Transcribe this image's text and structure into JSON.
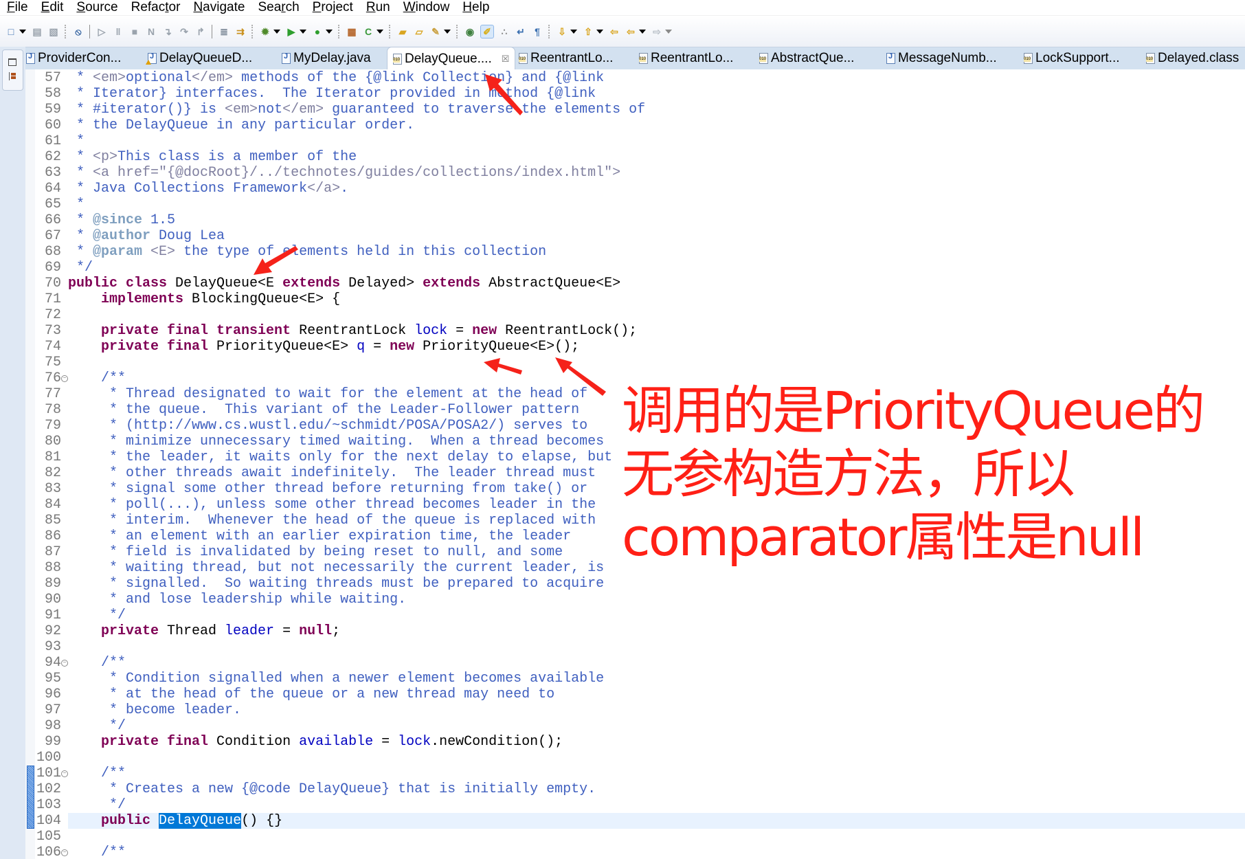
{
  "menubar": {
    "items": [
      {
        "label": "File",
        "mnemonic": 0
      },
      {
        "label": "Edit",
        "mnemonic": 0
      },
      {
        "label": "Source",
        "mnemonic": 0
      },
      {
        "label": "Refactor",
        "mnemonic": 5
      },
      {
        "label": "Navigate",
        "mnemonic": 0
      },
      {
        "label": "Search",
        "mnemonic": 3
      },
      {
        "label": "Project",
        "mnemonic": 0
      },
      {
        "label": "Run",
        "mnemonic": 0
      },
      {
        "label": "Window",
        "mnemonic": 0
      },
      {
        "label": "Help",
        "mnemonic": 0
      }
    ]
  },
  "toolbar": {
    "icons": [
      "new-icon",
      "dropdown",
      "save-icon",
      "save-all-icon",
      "sep",
      "skip-breakpoints-icon",
      "sep-solid",
      "resume-icon",
      "suspend-icon",
      "terminate-icon",
      "disconnect-icon",
      "step-into-icon",
      "step-over-icon",
      "step-return-icon",
      "sep-solid",
      "drop-to-frame-icon",
      "use-step-filters-icon",
      "sep",
      "debug-icon",
      "dropdown",
      "run-icon",
      "dropdown",
      "run-external-tool-icon",
      "dropdown",
      "sep",
      "new-java-package-icon",
      "new-java-class-icon",
      "dropdown",
      "sep",
      "open-type-icon",
      "open-task-icon",
      "search-icon",
      "dropdown",
      "sep",
      "toggle-breadcrumb-icon",
      "toggle-mark-occurrences-icon",
      "toggle-block-selection-icon",
      "word-wrap-icon",
      "show-whitespace-icon",
      "sep",
      "next-annotation-icon",
      "dropdown",
      "previous-annotation-icon",
      "dropdown",
      "last-edit-location-icon",
      "back-icon",
      "dropdown",
      "forward-icon",
      "dropdown-disabled"
    ]
  },
  "tabs": [
    {
      "label": "ProviderCon...",
      "icon": "java-file-icon",
      "active": false
    },
    {
      "label": "DelayQueueD...",
      "icon": "java-file-warning-icon",
      "active": false
    },
    {
      "label": "MyDelay.java",
      "icon": "java-file-icon",
      "active": false
    },
    {
      "label": "DelayQueue....",
      "icon": "class-file-icon",
      "active": true,
      "close": "☒"
    },
    {
      "label": "ReentrantLo...",
      "icon": "class-file-icon",
      "active": false
    },
    {
      "label": "ReentrantLo...",
      "icon": "class-file-icon",
      "active": false
    },
    {
      "label": "AbstractQue...",
      "icon": "class-file-icon",
      "active": false
    },
    {
      "label": "MessageNumb...",
      "icon": "java-file-icon",
      "active": false
    },
    {
      "label": "LockSupport...",
      "icon": "class-file-icon",
      "active": false
    },
    {
      "label": "Delayed.class",
      "icon": "class-file-icon",
      "active": false
    }
  ],
  "editor": {
    "current_line": 104,
    "folded_lines": [
      76,
      94,
      101,
      106
    ],
    "marker_lines": [
      101,
      104
    ],
    "lines": [
      {
        "n": 57,
        "t": [
          [
            "doc",
            " * "
          ],
          [
            "html",
            "<em>"
          ],
          [
            "doc",
            "optional"
          ],
          [
            "html",
            "</em>"
          ],
          [
            "doc",
            " methods of the {@link Collection} and {@link"
          ]
        ]
      },
      {
        "n": 58,
        "t": [
          [
            "doc",
            " * Iterator} interfaces.  The Iterator provided in method {@link"
          ]
        ]
      },
      {
        "n": 59,
        "t": [
          [
            "doc",
            " * #iterator()} is "
          ],
          [
            "html",
            "<em>"
          ],
          [
            "doc",
            "not"
          ],
          [
            "html",
            "</em>"
          ],
          [
            "doc",
            " guaranteed to traverse the elements of"
          ]
        ]
      },
      {
        "n": 60,
        "t": [
          [
            "doc",
            " * the DelayQueue in any particular order."
          ]
        ]
      },
      {
        "n": 61,
        "t": [
          [
            "doc",
            " *"
          ]
        ]
      },
      {
        "n": 62,
        "t": [
          [
            "doc",
            " * "
          ],
          [
            "html",
            "<p>"
          ],
          [
            "doc",
            "This class is a member of the"
          ]
        ]
      },
      {
        "n": 63,
        "t": [
          [
            "doc",
            " * "
          ],
          [
            "html",
            "<a href=\"{@docRoot}/../technotes/guides/collections/index.html\">"
          ]
        ]
      },
      {
        "n": 64,
        "t": [
          [
            "doc",
            " * Java Collections Framework"
          ],
          [
            "html",
            "</a>"
          ],
          [
            "doc",
            "."
          ]
        ]
      },
      {
        "n": 65,
        "t": [
          [
            "doc",
            " *"
          ]
        ]
      },
      {
        "n": 66,
        "t": [
          [
            "doc",
            " * "
          ],
          [
            "tag",
            "@since"
          ],
          [
            "doc",
            " 1.5"
          ]
        ]
      },
      {
        "n": 67,
        "t": [
          [
            "doc",
            " * "
          ],
          [
            "tag",
            "@author"
          ],
          [
            "doc",
            " Doug Lea"
          ]
        ]
      },
      {
        "n": 68,
        "t": [
          [
            "doc",
            " * "
          ],
          [
            "tag",
            "@param"
          ],
          [
            "doc",
            " "
          ],
          [
            "html",
            "<E>"
          ],
          [
            "doc",
            " the type of elements held in this collection"
          ]
        ]
      },
      {
        "n": 69,
        "t": [
          [
            "doc",
            " */"
          ]
        ]
      },
      {
        "n": 70,
        "t": [
          [
            "kw",
            "public class"
          ],
          [
            "txt",
            " DelayQueue<E "
          ],
          [
            "kw",
            "extends"
          ],
          [
            "txt",
            " Delayed> "
          ],
          [
            "kw",
            "extends"
          ],
          [
            "txt",
            " AbstractQueue<E>"
          ]
        ]
      },
      {
        "n": 71,
        "t": [
          [
            "txt",
            "    "
          ],
          [
            "kw",
            "implements"
          ],
          [
            "txt",
            " BlockingQueue<E> {"
          ]
        ]
      },
      {
        "n": 72,
        "t": []
      },
      {
        "n": 73,
        "t": [
          [
            "txt",
            "    "
          ],
          [
            "kw",
            "private final transient"
          ],
          [
            "txt",
            " ReentrantLock "
          ],
          [
            "field",
            "lock"
          ],
          [
            "txt",
            " = "
          ],
          [
            "kw",
            "new"
          ],
          [
            "txt",
            " ReentrantLock();"
          ]
        ]
      },
      {
        "n": 74,
        "t": [
          [
            "txt",
            "    "
          ],
          [
            "kw",
            "private final"
          ],
          [
            "txt",
            " PriorityQueue<E> "
          ],
          [
            "field",
            "q"
          ],
          [
            "txt",
            " = "
          ],
          [
            "kw",
            "new"
          ],
          [
            "txt",
            " PriorityQueue<E>();"
          ]
        ]
      },
      {
        "n": 75,
        "t": []
      },
      {
        "n": 76,
        "t": [
          [
            "doc",
            "    /**"
          ]
        ]
      },
      {
        "n": 77,
        "t": [
          [
            "doc",
            "     * Thread designated to wait for the element at the head of"
          ]
        ]
      },
      {
        "n": 78,
        "t": [
          [
            "doc",
            "     * the queue.  This variant of the Leader-Follower pattern"
          ]
        ]
      },
      {
        "n": 79,
        "t": [
          [
            "doc",
            "     * (http://www.cs.wustl.edu/~schmidt/POSA/POSA2/) serves to"
          ]
        ]
      },
      {
        "n": 80,
        "t": [
          [
            "doc",
            "     * minimize unnecessary timed waiting.  When a thread becomes"
          ]
        ]
      },
      {
        "n": 81,
        "t": [
          [
            "doc",
            "     * the leader, it waits only for the next delay to elapse, but"
          ]
        ]
      },
      {
        "n": 82,
        "t": [
          [
            "doc",
            "     * other threads await indefinitely.  The leader thread must"
          ]
        ]
      },
      {
        "n": 83,
        "t": [
          [
            "doc",
            "     * signal some other thread before returning from take() or"
          ]
        ]
      },
      {
        "n": 84,
        "t": [
          [
            "doc",
            "     * poll(...), unless some other thread becomes leader in the"
          ]
        ]
      },
      {
        "n": 85,
        "t": [
          [
            "doc",
            "     * interim.  Whenever the head of the queue is replaced with"
          ]
        ]
      },
      {
        "n": 86,
        "t": [
          [
            "doc",
            "     * an element with an earlier expiration time, the leader"
          ]
        ]
      },
      {
        "n": 87,
        "t": [
          [
            "doc",
            "     * field is invalidated by being reset to null, and some"
          ]
        ]
      },
      {
        "n": 88,
        "t": [
          [
            "doc",
            "     * waiting thread, but not necessarily the current leader, is"
          ]
        ]
      },
      {
        "n": 89,
        "t": [
          [
            "doc",
            "     * signalled.  So waiting threads must be prepared to acquire"
          ]
        ]
      },
      {
        "n": 90,
        "t": [
          [
            "doc",
            "     * and lose leadership while waiting."
          ]
        ]
      },
      {
        "n": 91,
        "t": [
          [
            "doc",
            "     */"
          ]
        ]
      },
      {
        "n": 92,
        "t": [
          [
            "txt",
            "    "
          ],
          [
            "kw",
            "private"
          ],
          [
            "txt",
            " Thread "
          ],
          [
            "field",
            "leader"
          ],
          [
            "txt",
            " = "
          ],
          [
            "kw",
            "null"
          ],
          [
            "txt",
            ";"
          ]
        ]
      },
      {
        "n": 93,
        "t": []
      },
      {
        "n": 94,
        "t": [
          [
            "doc",
            "    /**"
          ]
        ]
      },
      {
        "n": 95,
        "t": [
          [
            "doc",
            "     * Condition signalled when a newer element becomes available"
          ]
        ]
      },
      {
        "n": 96,
        "t": [
          [
            "doc",
            "     * at the head of the queue or a new thread may need to"
          ]
        ]
      },
      {
        "n": 97,
        "t": [
          [
            "doc",
            "     * become leader."
          ]
        ]
      },
      {
        "n": 98,
        "t": [
          [
            "doc",
            "     */"
          ]
        ]
      },
      {
        "n": 99,
        "t": [
          [
            "txt",
            "    "
          ],
          [
            "kw",
            "private final"
          ],
          [
            "txt",
            " Condition "
          ],
          [
            "field",
            "available"
          ],
          [
            "txt",
            " = "
          ],
          [
            "field",
            "lock"
          ],
          [
            "txt",
            ".newCondition();"
          ]
        ]
      },
      {
        "n": 100,
        "t": []
      },
      {
        "n": 101,
        "t": [
          [
            "doc",
            "    /**"
          ]
        ]
      },
      {
        "n": 102,
        "t": [
          [
            "doc",
            "     * Creates a new {@code DelayQueue} that is initially empty."
          ]
        ]
      },
      {
        "n": 103,
        "t": [
          [
            "doc",
            "     */"
          ]
        ]
      },
      {
        "n": 104,
        "t": [
          [
            "txt",
            "    "
          ],
          [
            "kw",
            "public"
          ],
          [
            "txt",
            " "
          ],
          [
            "sel",
            "DelayQueue"
          ],
          [
            "txt",
            "() {}"
          ]
        ]
      },
      {
        "n": 105,
        "t": []
      },
      {
        "n": 106,
        "t": [
          [
            "doc",
            "    /**"
          ]
        ]
      }
    ]
  },
  "annotation": {
    "lines": [
      "调用的是PriorityQueue的",
      "无参构造方法，所以",
      "comparator属性是null"
    ],
    "color": "#ff2016"
  },
  "arrows": {
    "color": "#f5221a",
    "count": 4
  },
  "colors": {
    "keyword": "#7f0055",
    "javadoc": "#3f5fbf",
    "javadoc_tag": "#7f9fbf",
    "html_tag": "#7f7f9f",
    "field": "#0000c0",
    "selection": "#0078d7",
    "current_line": "#e8f2fe"
  }
}
